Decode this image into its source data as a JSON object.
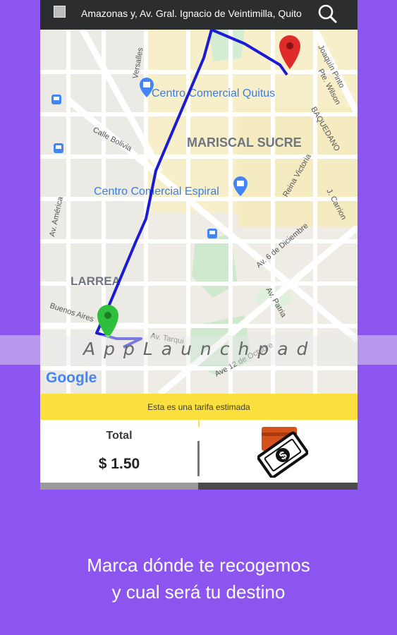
{
  "topbar": {
    "address": "Amazonas y, Av. Gral. Ignacio de Veintimilla, Quito",
    "menu_icon": "menu-square-icon",
    "search_icon": "search-icon"
  },
  "map": {
    "labels": {
      "centro_quitus": "Centro Comercial Quitus",
      "mariscal": "MARISCAL SUCRE",
      "centro_espiral": "Centro Comercial Espiral",
      "larrea": "LARREA",
      "versalles": "Versalles",
      "calle_bolivia": "Calle Bolivia",
      "av_america": "Av. América",
      "buenos_aires": "Buenos Aires",
      "av_tarqui": "Av. Tarqui",
      "ave_12_octubre": "Ave 12 de Octubre",
      "av_patria": "Av. Patria",
      "av_6_diciembre": "Av. 6 de Diciembre",
      "reina_victoria": "Reina Victoria",
      "baquedano": "BAQUEDANO",
      "joaquin_pinto": "Joaquín Pinto",
      "pte_wilson": "Pte. Wilson",
      "j_carrion": "J. Carrion",
      "google": "Google"
    },
    "colors": {
      "route": "#1b1bd6",
      "origin_pin": "#2fbf3c",
      "destination_pin": "#e02b2b",
      "poi": "#4285f4"
    }
  },
  "watermark": "AppLaunchpad",
  "fare": {
    "estimate_text": "Esta es una tarifa estimada",
    "total_label": "Total",
    "total_value": "$ 1.50",
    "payment_icon": "cash-wallet-icon"
  },
  "caption": {
    "line1": "Marca dónde te recogemos",
    "line2": "y cual será tu destino"
  }
}
